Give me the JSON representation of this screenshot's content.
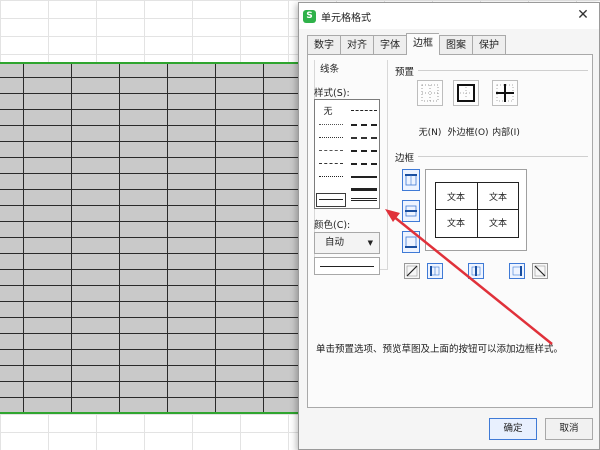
{
  "dialog": {
    "title": "单元格格式",
    "app_icon_letter": "S",
    "tabs": [
      {
        "label": "数字"
      },
      {
        "label": "对齐"
      },
      {
        "label": "字体"
      },
      {
        "label": "边框",
        "active": true
      },
      {
        "label": "图案"
      },
      {
        "label": "保护"
      }
    ]
  },
  "lines": {
    "group_label": "线条",
    "style_label": "样式(S):",
    "none_label": "无",
    "color_label": "颜色(C):",
    "color_value": "自动"
  },
  "presets": {
    "group_label": "预置",
    "items": [
      {
        "label": "无(N)",
        "icon": "border-none-icon"
      },
      {
        "label": "外边框(O)",
        "icon": "border-outline-icon"
      },
      {
        "label": "内部(I)",
        "icon": "border-inside-icon"
      }
    ]
  },
  "borders": {
    "group_label": "边框",
    "cells": [
      "文本",
      "文本",
      "文本",
      "文本"
    ]
  },
  "hint": "单击预置选项、预览草图及上面的按钮可以添加边框样式。",
  "buttons": {
    "ok": "确定",
    "cancel": "取消"
  },
  "colors": {
    "selection_border": "#2fa52f",
    "selection_fill": "#c9c9c9",
    "arrow": "#e0313a",
    "active_button": "#3f7ad6",
    "app_icon": "#2fb24a"
  }
}
